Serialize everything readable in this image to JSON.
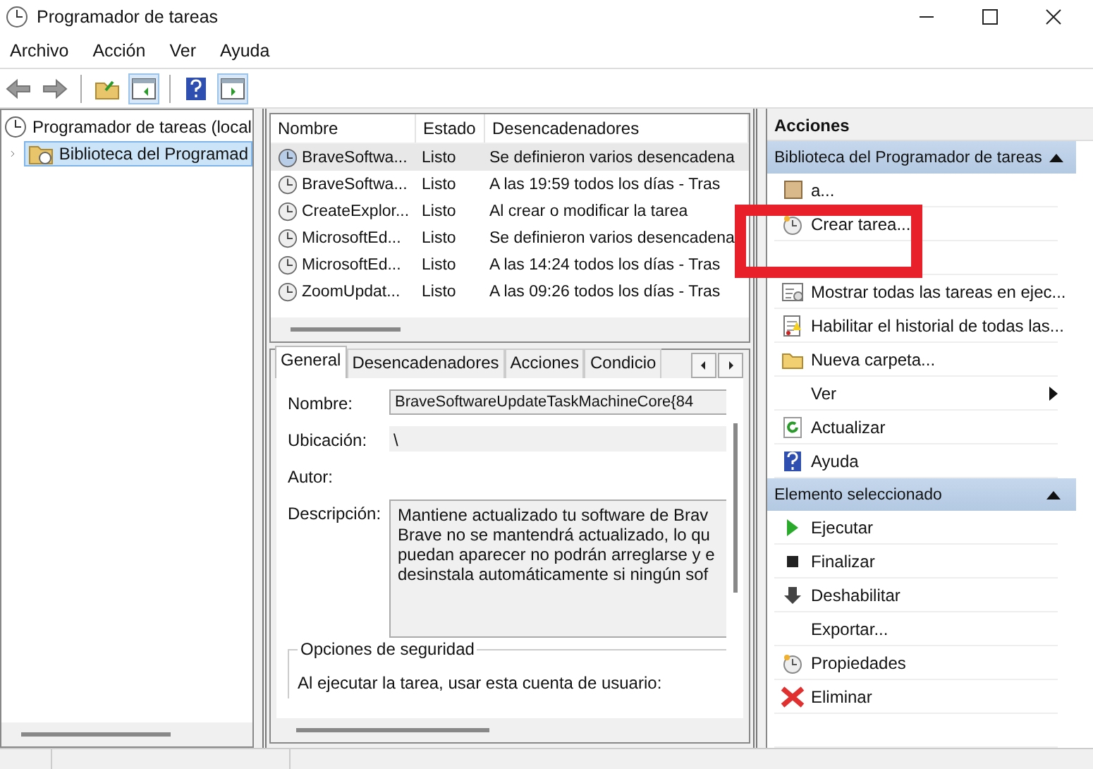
{
  "window": {
    "title": "Programador de tareas"
  },
  "menu": [
    "Archivo",
    "Acción",
    "Ver",
    "Ayuda"
  ],
  "toolbar": [
    {
      "kind": "back",
      "on": false
    },
    {
      "kind": "forward",
      "on": false
    },
    {
      "kind": "sep"
    },
    {
      "kind": "folder",
      "on": false
    },
    {
      "kind": "panel-left",
      "on": true
    },
    {
      "kind": "sep"
    },
    {
      "kind": "help",
      "on": false
    },
    {
      "kind": "panel-right",
      "on": true
    }
  ],
  "tree": [
    {
      "label": "Programador de tareas (local",
      "expanded": true,
      "children": [
        {
          "label": "Biblioteca del Programad",
          "selected": true,
          "expanded": false
        }
      ]
    }
  ],
  "table": {
    "columns": [
      "Nombre",
      "Estado",
      "Desencadenadores"
    ],
    "rows": [
      {
        "cells": [
          "BraveSoftwa...",
          "Listo",
          "Se definieron varios desencadena"
        ],
        "selected": true
      },
      {
        "cells": [
          "BraveSoftwa...",
          "Listo",
          "A las 19:59 todos los días - Tras"
        ],
        "selected": false
      },
      {
        "cells": [
          "CreateExplor...",
          "Listo",
          "Al crear o modificar la tarea"
        ],
        "selected": false
      },
      {
        "cells": [
          "MicrosoftEd...",
          "Listo",
          "Se definieron varios desencadena"
        ],
        "selected": false
      },
      {
        "cells": [
          "MicrosoftEd...",
          "Listo",
          "A las 14:24 todos los días - Tras"
        ],
        "selected": false
      },
      {
        "cells": [
          "ZoomUpdat...",
          "Listo",
          "A las 09:26 todos los días - Tras"
        ],
        "selected": false
      }
    ]
  },
  "detail": {
    "tabs": [
      {
        "label": "General",
        "selected": true
      },
      {
        "label": "Desencadenadores",
        "selected": false
      },
      {
        "label": "Acciones",
        "selected": false
      },
      {
        "label": "Condicio",
        "selected": false
      }
    ],
    "fields": [
      {
        "kind": "box",
        "label": "Nombre:",
        "value": "BraveSoftwareUpdateTaskMachineCore{84"
      },
      {
        "kind": "plain",
        "label": "Ubicación:",
        "value": "\\"
      },
      {
        "kind": "plain",
        "label": "Autor:"
      },
      {
        "kind": "multi",
        "label": "Descripción:",
        "lines": [
          "Mantiene actualizado tu software de Brav",
          "Brave no se mantendrá actualizado, lo qu",
          "puedan aparecer no podrán arreglarse y e",
          "desinstala automáticamente si ningún sof"
        ]
      }
    ],
    "security": {
      "title": "Opciones de seguridad",
      "text": "Al ejecutar la tarea, usar esta cuenta de usuario:"
    }
  },
  "actions": {
    "title": "Acciones",
    "sections": [
      {
        "title": "Biblioteca del Programador de tareas",
        "expanded": true,
        "items": [
          {
            "kind": "item",
            "label": "a..."
          },
          {
            "kind": "item",
            "label": "Crear tarea..."
          },
          {
            "kind": "hidden"
          },
          {
            "kind": "item",
            "label": "Mostrar todas las tareas en ejec..."
          },
          {
            "kind": "item",
            "label": "Habilitar el historial de todas las..."
          },
          {
            "kind": "item",
            "label": "Nueva carpeta..."
          },
          {
            "kind": "submenu",
            "label": "Ver"
          },
          {
            "kind": "item",
            "label": "Actualizar"
          },
          {
            "kind": "item",
            "label": "Ayuda"
          }
        ]
      },
      {
        "title": "Elemento seleccionado",
        "expanded": true,
        "items": [
          {
            "kind": "item",
            "label": "Ejecutar"
          },
          {
            "kind": "item",
            "label": "Finalizar"
          },
          {
            "kind": "item",
            "label": "Deshabilitar"
          },
          {
            "kind": "item",
            "label": "Exportar..."
          },
          {
            "kind": "item",
            "label": "Propiedades"
          },
          {
            "kind": "item",
            "label": "Eliminar"
          },
          {
            "kind": "hidden"
          }
        ]
      }
    ]
  }
}
